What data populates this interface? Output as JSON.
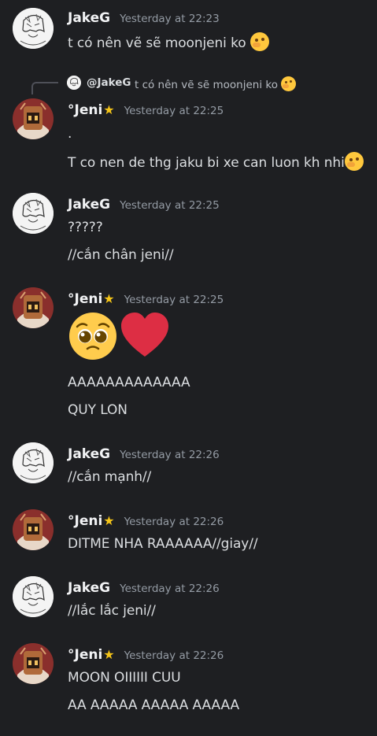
{
  "messages": [
    {
      "author": "JakeG",
      "timestamp": "Yesterday at 22:23",
      "lines": [
        "t có nên vẽ sẽ moonjeni ko"
      ]
    },
    {
      "author": "°Jeni",
      "timestamp": "Yesterday at 22:25",
      "reply": {
        "author": "@JakeG",
        "text": "t có nên vẽ sẽ moonjeni ko"
      },
      "lines": [
        ".",
        "T co nen de thg jaku bi xe can luon kh nhi"
      ]
    },
    {
      "author": "JakeG",
      "timestamp": "Yesterday at 22:25",
      "lines": [
        "?????",
        "//cắn chân jeni//"
      ]
    },
    {
      "author": "°Jeni",
      "timestamp": "Yesterday at 22:25",
      "emoji": [
        "pleading-face",
        "red-heart"
      ],
      "lines": [
        "AAAAAAAAAAAAA",
        "QUY LON"
      ]
    },
    {
      "author": "JakeG",
      "timestamp": "Yesterday at 22:26",
      "lines": [
        "//cắn mạnh//"
      ]
    },
    {
      "author": "°Jeni",
      "timestamp": "Yesterday at 22:26",
      "lines": [
        "DITME NHA RAAAAAA//giay//"
      ]
    },
    {
      "author": "JakeG",
      "timestamp": "Yesterday at 22:26",
      "lines": [
        "//lắc lắc jeni//"
      ]
    },
    {
      "author": "°Jeni",
      "timestamp": "Yesterday at 22:26",
      "lines": [
        "MOON OIIIIII CUU",
        "AA AAAAA AAAAA AAAAA"
      ]
    }
  ],
  "icons": {
    "star": "★",
    "thinking": "thinking-face"
  },
  "colors": {
    "background": "#1e1f22",
    "name": "#f2f3f5",
    "text": "#dbdee1",
    "timestamp": "#949ba4",
    "heart": "#dd2e44"
  }
}
